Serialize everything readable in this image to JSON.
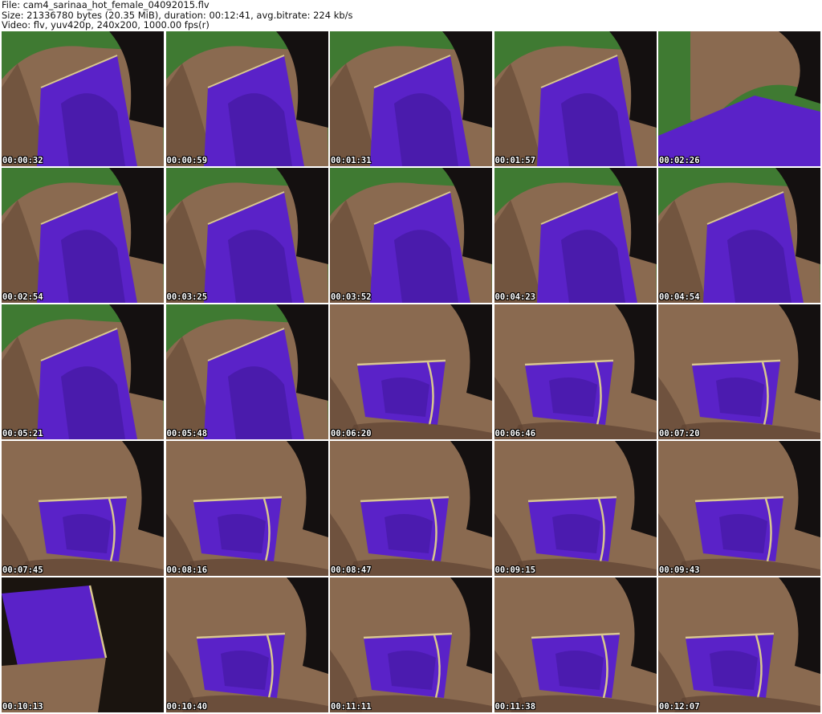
{
  "header": {
    "file_line": "File: cam4_sarinaa_hot_female_04092015.flv",
    "size_line": "Size: 21336780 bytes (20.35 MiB), duration: 00:12:41, avg.bitrate: 224 kb/s",
    "video_line": "Video: flv, yuv420p, 240x200, 1000.00 fps(r)"
  },
  "thumbnails": [
    {
      "timestamp": "00:00:32",
      "scene": "seated-drape"
    },
    {
      "timestamp": "00:00:59",
      "scene": "seated-drape"
    },
    {
      "timestamp": "00:01:31",
      "scene": "seated-drape"
    },
    {
      "timestamp": "00:01:57",
      "scene": "seated-drape"
    },
    {
      "timestamp": "00:02:26",
      "scene": "arm-raised"
    },
    {
      "timestamp": "00:02:54",
      "scene": "seated-drape"
    },
    {
      "timestamp": "00:03:25",
      "scene": "seated-drape"
    },
    {
      "timestamp": "00:03:52",
      "scene": "seated-drape"
    },
    {
      "timestamp": "00:04:23",
      "scene": "seated-drape"
    },
    {
      "timestamp": "00:04:54",
      "scene": "seated-drape"
    },
    {
      "timestamp": "00:05:21",
      "scene": "seated-drape"
    },
    {
      "timestamp": "00:05:48",
      "scene": "seated-drape"
    },
    {
      "timestamp": "00:06:20",
      "scene": "wrapped-close"
    },
    {
      "timestamp": "00:06:46",
      "scene": "wrapped-close"
    },
    {
      "timestamp": "00:07:20",
      "scene": "wrapped-close"
    },
    {
      "timestamp": "00:07:45",
      "scene": "wrapped-close"
    },
    {
      "timestamp": "00:08:16",
      "scene": "wrapped-close"
    },
    {
      "timestamp": "00:08:47",
      "scene": "wrapped-close"
    },
    {
      "timestamp": "00:09:15",
      "scene": "wrapped-close"
    },
    {
      "timestamp": "00:09:43",
      "scene": "wrapped-close"
    },
    {
      "timestamp": "00:10:13",
      "scene": "blurred-dark"
    },
    {
      "timestamp": "00:10:40",
      "scene": "wrapped-close"
    },
    {
      "timestamp": "00:11:11",
      "scene": "wrapped-close"
    },
    {
      "timestamp": "00:11:38",
      "scene": "wrapped-close"
    },
    {
      "timestamp": "00:12:07",
      "scene": "wrapped-close"
    }
  ],
  "colors": {
    "background": "#ffffff",
    "fabric_purple": "#5a22c8",
    "fabric_dark": "#3a1490",
    "skin": "#8a6a50",
    "skin_shadow": "#5e4332",
    "hair": "#141010",
    "wall_green": "#3f7a32",
    "trim_gold": "#d9c78e"
  }
}
